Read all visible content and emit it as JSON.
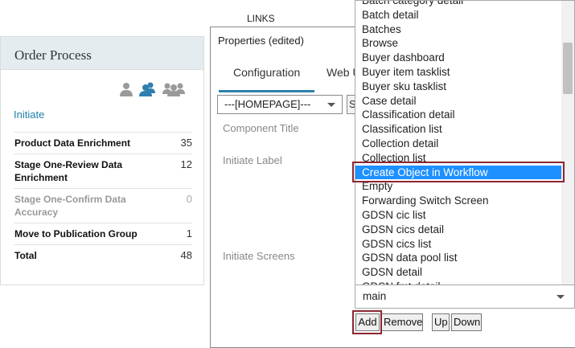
{
  "links_label": "LINKS",
  "order_process": {
    "title": "Order Process",
    "initiate_link": "Initiate",
    "rows": [
      {
        "label": "Product Data Enrichment",
        "value": "35",
        "muted": false
      },
      {
        "label": "Stage One-Review Data Enrichment",
        "value": "12",
        "muted": false
      },
      {
        "label": "Stage One-Confirm Data Accuracy",
        "value": "0",
        "muted": true
      },
      {
        "label": "Move to Publication Group",
        "value": "1",
        "muted": false
      },
      {
        "label": "Total",
        "value": "48",
        "muted": false
      }
    ],
    "icons": [
      "user-icon",
      "users-icon",
      "user-group-icon"
    ]
  },
  "properties": {
    "title": "Properties (edited)",
    "tabs": [
      {
        "label": "Configuration",
        "active": true
      },
      {
        "label": "Web U",
        "active": false
      }
    ],
    "homepage_select": "---[HOMEPAGE]---",
    "s_button": "S",
    "fields": [
      "Component Title",
      "Initiate Label",
      "Initiate Screens"
    ]
  },
  "dropdown": {
    "items": [
      "Batch category detail",
      "Batch detail",
      "Batches",
      "Browse",
      "Buyer dashboard",
      "Buyer item tasklist",
      "Buyer sku tasklist",
      "Case detail",
      "Classification detail",
      "Classification list",
      "Collection detail",
      "Collection list",
      "Create Object in Workflow",
      "Empty",
      "Forwarding Switch Screen",
      "GDSN cic list",
      "GDSN cics detail",
      "GDSN cics list",
      "GDSN data pool list",
      "GDSN detail",
      "GDSN fmt detail"
    ],
    "selected": "Create Object in Workflow"
  },
  "main_select": "main",
  "buttons": {
    "add": "Add",
    "remove": "Remove",
    "up": "Up",
    "down": "Down"
  },
  "colors": {
    "accent": "#2f7fae",
    "selection": "#1e90ff",
    "highlight": "#8b2631",
    "link": "#1e7fa8"
  }
}
